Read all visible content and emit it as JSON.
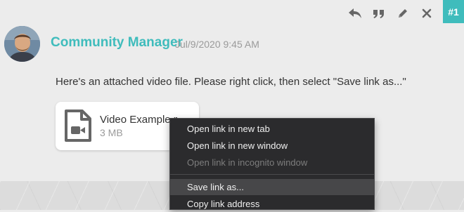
{
  "post": {
    "number": "#1",
    "author": "Community Manager",
    "timestamp": "Jul/9/2020 9:45 AM",
    "message": "Here's an attached video file. Please right click, then select \"Save link as...\"",
    "actions": [
      {
        "name": "reply-icon"
      },
      {
        "name": "quote-icon"
      },
      {
        "name": "edit-icon"
      },
      {
        "name": "delete-icon"
      }
    ]
  },
  "attachment": {
    "name": "Video Example.mp4",
    "size": "3 MB",
    "icon": "video-file-icon"
  },
  "context_menu": {
    "items": [
      {
        "label": "Open link in new tab",
        "enabled": true
      },
      {
        "label": "Open link in new window",
        "enabled": true
      },
      {
        "label": "Open link in incognito window",
        "enabled": false
      },
      {
        "label": "Save link as...",
        "enabled": true,
        "highlighted": true
      },
      {
        "label": "Copy link address",
        "enabled": true
      }
    ]
  },
  "colors": {
    "accent": "#3fbcbc",
    "menu_bg": "#2b2b2d",
    "menu_highlight": "#474749"
  }
}
